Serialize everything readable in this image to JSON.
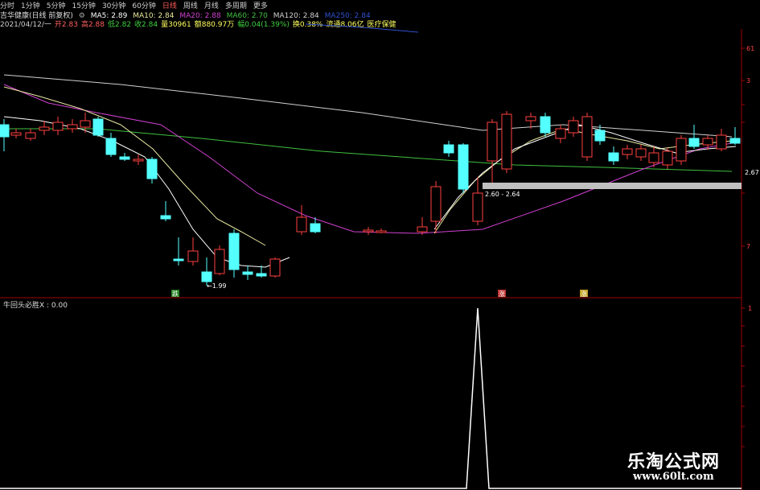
{
  "toolbar": {
    "items": [
      "分时",
      "1分钟",
      "5分钟",
      "15分钟",
      "30分钟",
      "60分钟",
      "日线",
      "周线",
      "月线",
      "多周期",
      "更多"
    ],
    "active": "日线",
    "active_color": "#ff5a5a"
  },
  "info": {
    "stock": "吉华健康(日线 前复权)",
    "ma5": "MA5: 2.89",
    "ma10": "MA10: 2.84",
    "ma20": "MA20: 2.88",
    "ma60": "MA60: 2.70",
    "ma120": "MA120: 2.84",
    "ma250": "MA250: 2.84",
    "line2": [
      "2021/04/12/一",
      "开2.83",
      "高2.88",
      "低2.82",
      "收2.84",
      "量30961",
      "额880.97万",
      "幅0.04(1.39%)",
      "换0.38%",
      "流通8.06亿",
      "医疗保健"
    ]
  },
  "colors": {
    "ma5": "#ffffff",
    "ma10": "#e8e8a0",
    "ma20": "#d040d0",
    "ma60": "#40c040",
    "ma120": "#d0d0d0",
    "ma250": "#3050d0",
    "up": "#ff4040",
    "down": "#54ffff",
    "indicator": "#ffffff",
    "axis": "#a00000"
  },
  "chart_data": {
    "type": "candlestick",
    "annotations": {
      "low_label": "1.99",
      "support_band": "2.60 - 2.64",
      "right_tick": "2.67",
      "signal_1": "跌",
      "signal_2": "涨",
      "signal_3": "涨"
    },
    "indicator": {
      "name": "牛回头必胜X : 0.00",
      "spike_value": 1.0
    }
  },
  "watermark": {
    "line1": "乐淘公式网",
    "line2": "www.60lt.com"
  }
}
